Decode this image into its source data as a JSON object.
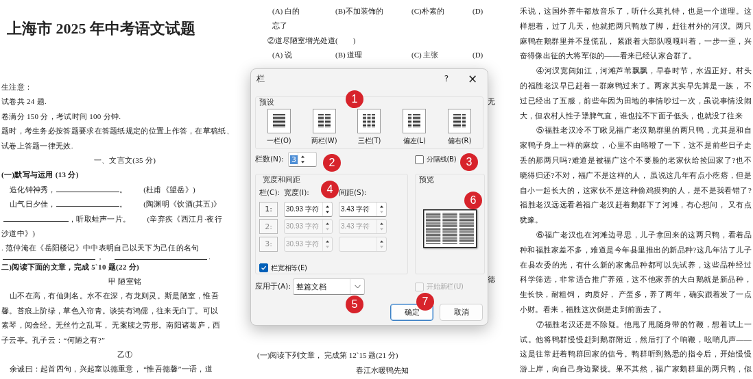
{
  "left_page": {
    "title": "上海市 2025 年中考语文试题",
    "lines": [
      {
        "kind": "text",
        "text": "生注意："
      },
      {
        "kind": "text",
        "text": "试卷共 24 题."
      },
      {
        "kind": "text",
        "text": "卷满分 150 分，考试时间 100 分钟."
      },
      {
        "kind": "text",
        "text": "题时，考生务必按答题要求在答题纸规定的位置上作答，在草稿纸、"
      },
      {
        "kind": "text",
        "text": "试卷上答题一律无效."
      },
      {
        "kind": "center",
        "text": "一、文言文(35 分)"
      },
      {
        "kind": "bold",
        "text": "(一)默写与运用 (13 分)"
      },
      {
        "kind": "verse",
        "before": "造化钟神秀，",
        "after": "。",
        "source": "(杜甫《望岳》)"
      },
      {
        "kind": "verse",
        "before": "山气日夕佳，",
        "after": "。",
        "source": "(陶渊明《饮酒(其五)》"
      },
      {
        "kind": "verse",
        "after": "，听取蛙声一片。",
        "source": "(辛弃疾《西江月·夜行"
      },
      {
        "kind": "text",
        "text": "沙道中》)"
      },
      {
        "kind": "text",
        "text": ". 范仲淹在《岳阳楼记》中中表明自己以天下为己任的名句"
      },
      {
        "kind": "blanks",
        "marks": [
          "，",
          "."
        ]
      },
      {
        "kind": "bold",
        "text": "二)阅读下面的文章，完成 5`10 题(22 分)"
      },
      {
        "kind": "center",
        "text": "甲 陋室铭"
      },
      {
        "kind": "indent",
        "text": "山不在高，有仙则名。水不在深，有龙则灵。斯是陋室，惟吾"
      },
      {
        "kind": "text",
        "text": "馨。苔痕上阶绿，草色入帘青。谈笑有鸿儒，往来无白丁。可以"
      },
      {
        "kind": "text",
        "text": "素琴，阅金经。无丝竹之乱耳， 无案牍之劳形。南阳诸葛庐，西"
      },
      {
        "kind": "text",
        "text": "子云亭。孔子云：“何陋之有?”"
      },
      {
        "kind": "center",
        "text": "乙①"
      },
      {
        "kind": "indent",
        "text": "余诚曰：起首四句，兴起室以德重意， “惟吾德馨”一语，道"
      }
    ]
  },
  "middle_page": {
    "top_lines": [
      {
        "kind": "options",
        "items": [
          "(A) 白的",
          "(B)不加装饰的",
          "(C)朴素的",
          "(D)"
        ]
      },
      {
        "kind": "indent",
        "text": "忘了"
      },
      {
        "kind": "text",
        "text": "②道尽陋室增光处道(　　)"
      },
      {
        "kind": "options",
        "items": [
          "(A) 说",
          "(B) 道理",
          "(C) 主张",
          "(D)"
        ]
      }
    ],
    "peeks": [
      "无",
      "德"
    ],
    "bottom_lines": [
      {
        "kind": "text",
        "text": "(一)阅读下列文章， 完成第 12`15 题(21 分)"
      },
      {
        "kind": "center",
        "text": "春江水暖鸭先知"
      }
    ]
  },
  "right_page": {
    "paragraphs": [
      {
        "indent": false,
        "complete": true,
        "lines": [
          "禾说，这国外养牛都放音乐了，听什么莫扎特，也是一个道理。这",
          "样想着，过了几天，他就把两只鸭放了脚，赶往村外的河汊。两只",
          "麻鸭在鹅群里并不显慌乱， 紧跟着大部队嘎嘎叫着，一步一歪，兴",
          "奋得像出征的大将军似的——看来已经认家合群了。"
        ]
      },
      {
        "indent": true,
        "complete": true,
        "lines": [
          "④河汊宽阔如江，河滩芦苇飘飘，早春时节，水温正好。村头",
          "的福胜老汉早已赶着一群麻鸭过来了。两家其实早先算是一族， 不",
          "过已经出了五服，前些年因为田地的事情吵过一次，虽说事情没闹",
          "大，但农村人性子犟脾气直，谁也拉不下面子低头，也就没了往来"
        ]
      },
      {
        "indent": true,
        "complete": true,
        "lines": [
          "⑤福胜老汉冷不丁瞅见福广老汉鹅群里的两只鸭，尤其是和自",
          "家鸭子身上一样的麻纹， 心里不由咯噔了一下，这不是前些日子走",
          "丢的那两只吗?难道是被福广这个不要脸的老家伙给捡回家了?也不",
          "晓得归还?不对，福广不是这样的人， 虽说这几年有点小疙瘩，但是",
          "自小一起长大的，这家伙不是这种偷鸡摸狗的人，是不是我看错了?",
          "福胜老汉远远看着福广老汉赶着鹅群下了河滩，有心想问， 又有点",
          "犹豫。"
        ]
      },
      {
        "indent": true,
        "complete": true,
        "lines": [
          "⑥福广老汉也在河滩边寻思，儿子拿回来的这两只鸭，看着品",
          "种和福胜家差不多，难道是今年县里推出的新品种?这几年沾了儿子",
          "在县农委的光，有什么新的家禽品种都可以先试养，这些品种经过",
          "科学筛选，非常适合推广养殖，这不他家养的大白鹅就是新品种，",
          "生长快，耐粗饲， 肉质好， 产蛋多，养了两年，确实跟着发了一点",
          "小财。看来，福胜这次倒是走到前面去了。"
        ]
      },
      {
        "indent": true,
        "complete": false,
        "lines": [
          "⑦福胜老汉还是不除疑。他甩了甩随身带的竹鞭，想着试上一",
          "试。他将鸭群慢慢赶到鹅群附近，然后打了个响鞭，吆哨几声——",
          "这是往常赶着鸭群回家的信号。鸭群听到熟悉的指令后，开始慢慢",
          "游上岸，向自己身边聚拢。果不其然，福广家鹅群里的两只鸭，似"
        ]
      }
    ]
  },
  "dialog": {
    "title": "栏",
    "help": "?",
    "close": "×",
    "presets": {
      "label": "预设",
      "items": [
        {
          "kind": "one",
          "label": "一栏(O)",
          "selected": false
        },
        {
          "kind": "two",
          "label": "两栏(W)",
          "selected": false
        },
        {
          "kind": "three",
          "label": "三栏(T)",
          "selected": false
        },
        {
          "kind": "left",
          "label": "偏左(L)",
          "selected": false
        },
        {
          "kind": "right",
          "label": "偏右(R)",
          "selected": false
        }
      ]
    },
    "column_count": {
      "label": "栏数(N):",
      "value": "3",
      "selected": true
    },
    "divider": {
      "label": "分隔线(B)",
      "checked": false
    },
    "width_spacing": {
      "label": "宽度和间距",
      "headers": [
        "栏(C):",
        "宽度(I):",
        "间距(S):"
      ],
      "rows": [
        {
          "number": "1:",
          "width": "30.93 字符",
          "spacing": "3.43 字符",
          "disabled": false
        },
        {
          "number": "2:",
          "width": "30.93 字符",
          "spacing": "3.43 字符",
          "disabled": true
        },
        {
          "number": "3:",
          "width": "30.93 字符",
          "disabled": true
        }
      ]
    },
    "equal_width": {
      "label": "栏宽相等(E)",
      "checked": true
    },
    "preview": {
      "label": "预览"
    },
    "apply_to": {
      "label": "应用于(A):",
      "value": "整篇文档"
    },
    "new_column": {
      "label": "开始新栏(U)",
      "checked": false,
      "disabled": true
    },
    "buttons": [
      {
        "label": "确定",
        "default": true
      },
      {
        "label": "取消",
        "default": false
      }
    ]
  },
  "annotations": [
    {
      "label": "1"
    },
    {
      "label": "2"
    },
    {
      "label": "3"
    },
    {
      "label": "4"
    },
    {
      "label": "5"
    },
    {
      "label": "6"
    },
    {
      "label": "7"
    }
  ]
}
